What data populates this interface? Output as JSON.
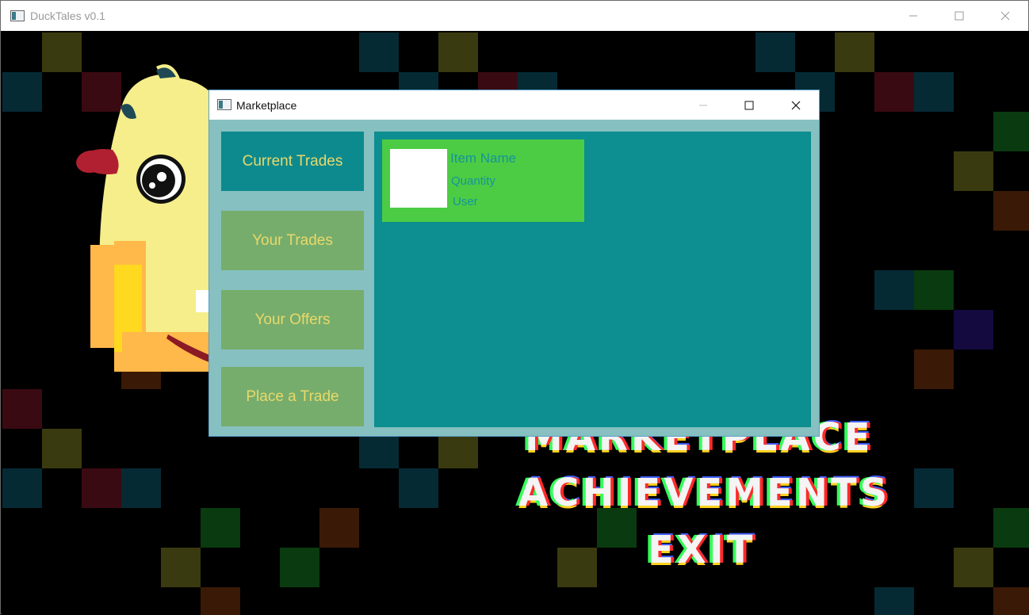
{
  "main_window": {
    "title": "DuckTales v0.1",
    "minimize_icon": "minimize-icon",
    "maximize_icon": "maximize-icon",
    "close_icon": "close-icon"
  },
  "game_menu": {
    "visible_items": [
      "MARKETPLACE",
      "ACHIEVEMENTS",
      "EXIT"
    ]
  },
  "marketplace": {
    "title": "Marketplace",
    "nav": [
      {
        "label": "Current Trades",
        "active": true
      },
      {
        "label": "Your Trades",
        "active": false
      },
      {
        "label": "Your Offers",
        "active": false
      },
      {
        "label": "Place a Trade",
        "active": false
      }
    ],
    "trade_card": {
      "item_name": "Item Name",
      "quantity": "Quantity",
      "user": "User"
    }
  },
  "colors": {
    "active_nav": "#0d8a8e",
    "inactive_nav": "#77ad6c",
    "nav_text": "#e8d96a",
    "content_bg": "#0d8e90",
    "card_bg": "#4ccc44",
    "dialog_bg": "#86c0c0"
  }
}
